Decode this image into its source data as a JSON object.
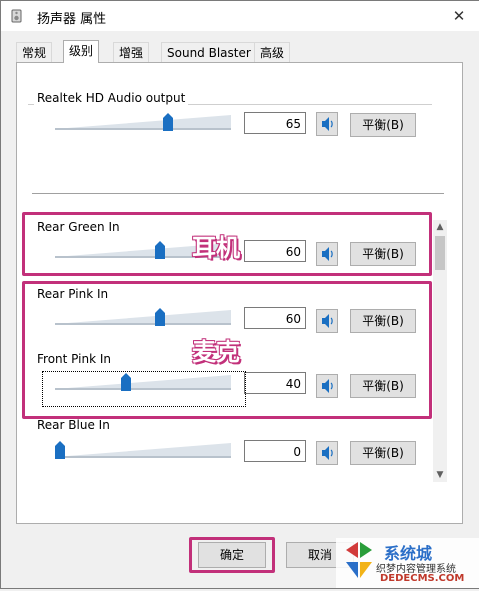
{
  "window": {
    "title": "扬声器 属性",
    "close_glyph": "✕"
  },
  "tabs": [
    {
      "label": "常规",
      "active": false
    },
    {
      "label": "级别",
      "active": true
    },
    {
      "label": "增强",
      "active": false
    },
    {
      "label": "Sound Blaster",
      "active": false
    },
    {
      "label": "高级",
      "active": false
    }
  ],
  "main_output": {
    "label": "Realtek HD Audio output",
    "value": "65",
    "balance_label": "平衡(B)",
    "level": 0.65
  },
  "inputs": [
    {
      "label": "Rear Green In",
      "value": "60",
      "balance_label": "平衡(B)",
      "level": 0.6
    },
    {
      "label": "Rear Pink In",
      "value": "60",
      "balance_label": "平衡(B)",
      "level": 0.6
    },
    {
      "label": "Front Pink In",
      "value": "40",
      "balance_label": "平衡(B)",
      "level": 0.4
    },
    {
      "label": "Rear Blue In",
      "value": "0",
      "balance_label": "平衡(B)",
      "level": 0.0
    }
  ],
  "annotations": {
    "headphones": "耳机",
    "microphone": "麦克"
  },
  "buttons": {
    "ok": "确定",
    "cancel": "取消"
  },
  "watermark": {
    "site_cn": "系统城",
    "tagline": "织梦内容管理系统",
    "domain": "DEDECMS.COM"
  },
  "colors": {
    "highlight": "#c2307a",
    "thumb": "#1a6fc2",
    "track_light": "#dce3ea"
  }
}
